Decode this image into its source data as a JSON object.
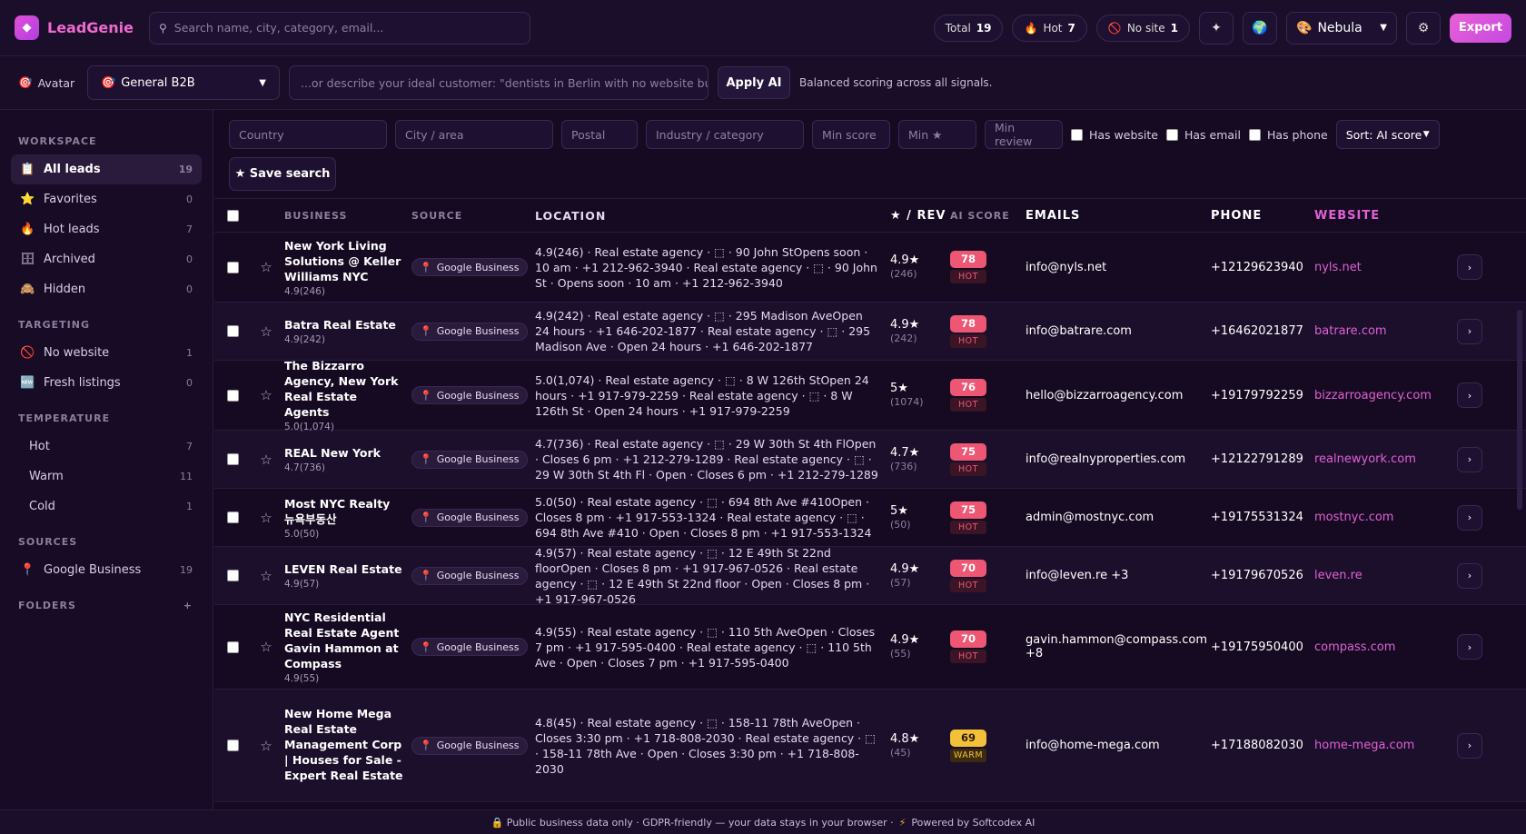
{
  "app": {
    "name": "LeadGenie",
    "logo_icon": "sparkle-icon"
  },
  "header": {
    "search_placeholder": "Search name, city, category, email...",
    "stats": [
      {
        "label": "Total",
        "value": "19",
        "icon": ""
      },
      {
        "label": "Hot",
        "value": "7",
        "icon": "🔥"
      },
      {
        "label": "No site",
        "value": "1",
        "icon": "🚫"
      }
    ],
    "theme": "Nebula",
    "export_label": "Export"
  },
  "avatar_bar": {
    "label": "Avatar",
    "selected": "General B2B",
    "describe_placeholder": "...or describe your ideal customer: \"dentists in Berlin with no website but go",
    "apply_label": "Apply AI",
    "note": "Balanced scoring across all signals."
  },
  "sidebar": {
    "workspace_title": "WORKSPACE",
    "workspace": [
      {
        "label": "All leads",
        "count": "19",
        "icon": "📋"
      },
      {
        "label": "Favorites",
        "count": "0",
        "icon": "⭐"
      },
      {
        "label": "Hot leads",
        "count": "7",
        "icon": "🔥"
      },
      {
        "label": "Archived",
        "count": "0",
        "icon": "🗄"
      },
      {
        "label": "Hidden",
        "count": "0",
        "icon": "🙈"
      }
    ],
    "targeting_title": "TARGETING",
    "targeting": [
      {
        "label": "No website",
        "count": "1",
        "icon": "🚫"
      },
      {
        "label": "Fresh listings",
        "count": "0",
        "icon": "🆕"
      }
    ],
    "temperature_title": "TEMPERATURE",
    "temperature": [
      {
        "label": "Hot",
        "count": "7"
      },
      {
        "label": "Warm",
        "count": "11"
      },
      {
        "label": "Cold",
        "count": "1"
      }
    ],
    "sources_title": "SOURCES",
    "sources": [
      {
        "label": "Google Business",
        "count": "19",
        "icon": "📍"
      }
    ],
    "folders_title": "FOLDERS",
    "folders_add": "+"
  },
  "filters": {
    "country": "Country",
    "city": "City / area",
    "postal": "Postal",
    "industry": "Industry / category",
    "min_score": "Min score",
    "min_star": "Min ★",
    "min_review": "Min review",
    "has_website": "Has website",
    "has_email": "Has email",
    "has_phone": "Has phone",
    "sort": "Sort: AI score",
    "save_search": "★ Save search"
  },
  "table": {
    "headers": {
      "business": "BUSINESS",
      "source": "SOURCE",
      "location": "LOCATION",
      "rev": "★ / REV",
      "score": "AI SCORE",
      "emails": "EMAILS",
      "phone": "PHONE",
      "website": "WEBSITE"
    },
    "rows": [
      {
        "name": "New York Living Solutions @ Keller Williams NYC",
        "sub": "4.9(246)",
        "source": "Google Business",
        "location": "4.9(246) · Real estate agency · ⬚ · 90 John StOpens soon · 10 am · +1 212-962-3940 · Real estate agency · ⬚ · 90 John St · Opens soon · 10 am · +1 212-962-3940",
        "stars": "4.9★",
        "reviews": "(246)",
        "score": "78",
        "tag": "HOT",
        "email": "info@nyls.net",
        "phone": "+12129623940",
        "website": "nyls.net"
      },
      {
        "name": "Batra Real Estate",
        "sub": "4.9(242)",
        "source": "Google Business",
        "location": "4.9(242) · Real estate agency · ⬚ · 295 Madison AveOpen 24 hours · +1 646-202-1877 · Real estate agency · ⬚ · 295 Madison Ave · Open 24 hours · +1 646-202-1877",
        "stars": "4.9★",
        "reviews": "(242)",
        "score": "78",
        "tag": "HOT",
        "email": "info@batrare.com",
        "phone": "+16462021877",
        "website": "batrare.com"
      },
      {
        "name": "The Bizzarro Agency, New York Real Estate Agents",
        "sub": "5.0(1,074)",
        "source": "Google Business",
        "location": "5.0(1,074) · Real estate agency · ⬚ · 8 W 126th StOpen 24 hours · +1 917-979-2259 · Real estate agency · ⬚ · 8 W 126th St · Open 24 hours · +1 917-979-2259",
        "stars": "5★",
        "reviews": "(1074)",
        "score": "76",
        "tag": "HOT",
        "email": "hello@bizzarroagency.com",
        "phone": "+19179792259",
        "website": "bizzarroagency.com"
      },
      {
        "name": "REAL New York",
        "sub": "4.7(736)",
        "source": "Google Business",
        "location": "4.7(736) · Real estate agency · ⬚ · 29 W 30th St 4th FlOpen · Closes 6 pm · +1 212-279-1289 · Real estate agency · ⬚ · 29 W 30th St 4th Fl · Open · Closes 6 pm · +1 212-279-1289",
        "stars": "4.7★",
        "reviews": "(736)",
        "score": "75",
        "tag": "HOT",
        "email": "info@realnyproperties.com",
        "phone": "+12122791289",
        "website": "realnewyork.com"
      },
      {
        "name": "Most NYC Realty 뉴욕부동산",
        "sub": "5.0(50)",
        "source": "Google Business",
        "location": "5.0(50) · Real estate agency · ⬚ · 694 8th Ave #410Open · Closes 8 pm · +1 917-553-1324 · Real estate agency · ⬚ · 694 8th Ave #410 · Open · Closes 8 pm · +1 917-553-1324",
        "stars": "5★",
        "reviews": "(50)",
        "score": "75",
        "tag": "HOT",
        "email": "admin@mostnyc.com",
        "phone": "+19175531324",
        "website": "mostnyc.com"
      },
      {
        "name": "LEVEN Real Estate",
        "sub": "4.9(57)",
        "source": "Google Business",
        "location": "4.9(57) · Real estate agency · ⬚ · 12 E 49th St 22nd floorOpen · Closes 8 pm · +1 917-967-0526 · Real estate agency · ⬚ · 12 E 49th St 22nd floor · Open · Closes 8 pm · +1 917-967-0526",
        "stars": "4.9★",
        "reviews": "(57)",
        "score": "70",
        "tag": "HOT",
        "email": "info@leven.re +3",
        "phone": "+19179670526",
        "website": "leven.re"
      },
      {
        "name": "NYC Residential Real Estate Agent Gavin Hammon at Compass",
        "sub": "4.9(55)",
        "source": "Google Business",
        "location": "4.9(55) · Real estate agency · ⬚ · 110 5th AveOpen · Closes 7 pm · +1 917-595-0400 · Real estate agency · ⬚ · 110 5th Ave · Open · Closes 7 pm · +1 917-595-0400",
        "stars": "4.9★",
        "reviews": "(55)",
        "score": "70",
        "tag": "HOT",
        "email": "gavin.hammon@compass.com +8",
        "phone": "+19175950400",
        "website": "compass.com"
      },
      {
        "name": "New Home Mega Real Estate Management Corp | Houses for Sale - Expert Real Estate",
        "sub": "",
        "source": "Google Business",
        "location": "4.8(45) · Real estate agency · ⬚ · 158-11 78th AveOpen · Closes 3:30 pm · +1 718-808-2030 · Real estate agency · ⬚ · 158-11 78th Ave · Open · Closes 3:30 pm · +1 718-808-2030",
        "stars": "4.8★",
        "reviews": "(45)",
        "score": "69",
        "tag": "WARM",
        "email": "info@home-mega.com",
        "phone": "+17188082030",
        "website": "home-mega.com"
      }
    ]
  },
  "footer": {
    "privacy": "🔒 Public business data only · GDPR-friendly — your data stays in your browser ·",
    "powered": "Powered by Softcodex AI"
  },
  "colors": {
    "accent": "#e060d4",
    "hot": "#ee5773",
    "warm": "#f3c03a",
    "background": "#160a22"
  }
}
